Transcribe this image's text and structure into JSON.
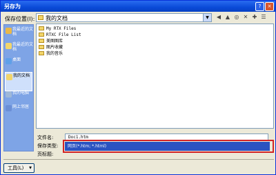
{
  "window": {
    "title": "另存为",
    "help": "?",
    "close": "×"
  },
  "save_in": {
    "label": "保存位置(I):",
    "value": "我的文档"
  },
  "places": [
    {
      "label": "我最近的文档"
    },
    {
      "label": "我最近的文档"
    },
    {
      "label": "桌面"
    },
    {
      "label": "我的文档"
    },
    {
      "label": "我的电脑"
    },
    {
      "label": "网上邻居"
    }
  ],
  "files": [
    {
      "name": "My RTX Files"
    },
    {
      "name": "RTXC File List"
    },
    {
      "name": "美图图库"
    },
    {
      "name": "图片收藏"
    },
    {
      "name": "我的音乐"
    }
  ],
  "form": {
    "filename_label": "文件名:",
    "filename_value": "Doc1.htm",
    "savetype_label": "保存类型:",
    "savetype_value": "网页(*.htm; *.html)",
    "pagetitle_label": "页标题:"
  },
  "tools": {
    "label": "工具(L)"
  }
}
